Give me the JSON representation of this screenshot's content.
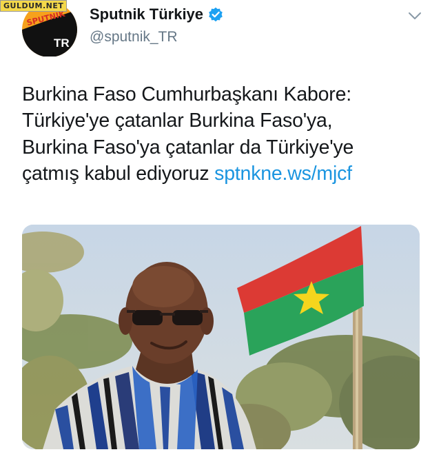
{
  "watermark": "GULDUM.NET",
  "account": {
    "display_name": "Sputnik Türkiye",
    "handle": "@sputnik_TR",
    "avatar_logo_text": "SPUTNIK",
    "avatar_region_text": "TR",
    "verified": true
  },
  "tweet": {
    "line1": "Burkina Faso Cumhurbaşkanı Kabore:",
    "line2": "Türkiye'ye çatanlar Burkina Faso'ya,",
    "line3": "Burkina Faso'ya çatanlar da Türkiye'ye",
    "line4_text": "çatmış kabul ediyoruz ",
    "link": "sptnkne.ws/mjcf"
  },
  "colors": {
    "text": "#14171a",
    "secondary": "#657786",
    "link": "#1b95e0",
    "verified": "#1da1f2",
    "brand_orange": "#f6a11c"
  },
  "icons": [
    "verified-badge-icon",
    "chevron-down-icon"
  ]
}
